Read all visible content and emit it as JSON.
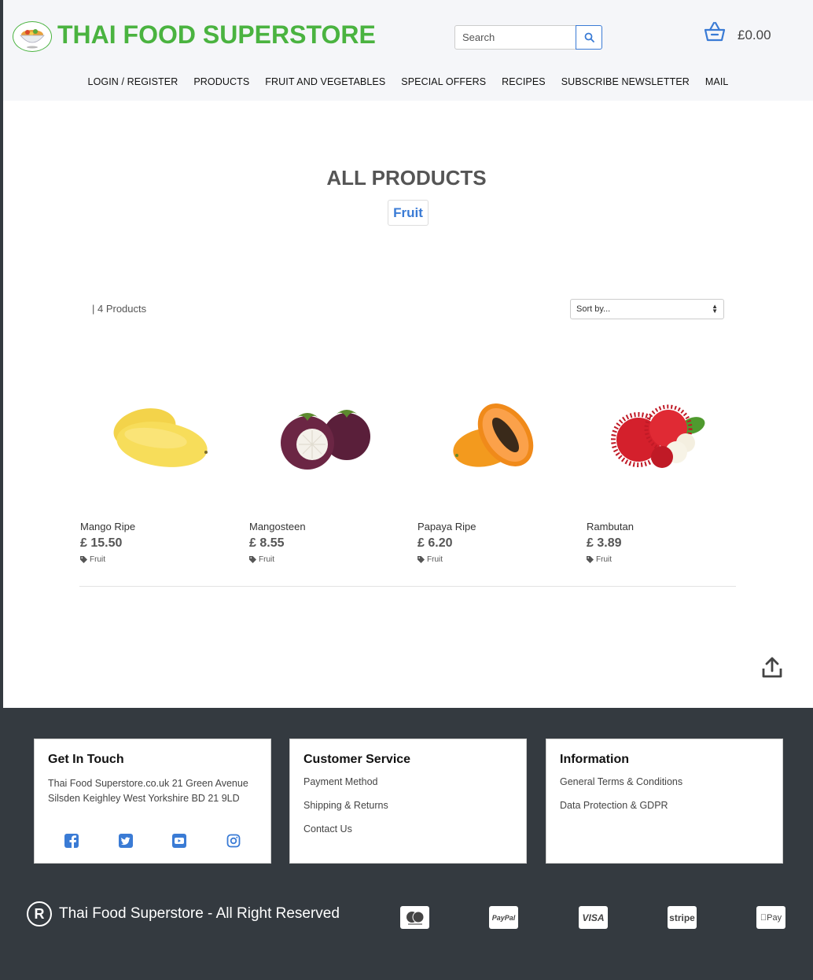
{
  "header": {
    "brand": "THAI FOOD SUPERSTORE",
    "search_placeholder": "Search",
    "cart_total": "£0.00",
    "nav": [
      "LOGIN / REGISTER",
      "PRODUCTS",
      "FRUIT AND VEGETABLES",
      "SPECIAL OFFERS",
      "RECIPES",
      "SUBSCRIBE NEWSLETTER",
      "MAIL"
    ]
  },
  "main": {
    "title": "ALL PRODUCTS",
    "category_badge": "Fruit",
    "product_count": "| 4 Products",
    "sort_label": "Sort by...",
    "products": [
      {
        "name": "Mango Ripe",
        "price": "£ 15.50",
        "category": "Fruit",
        "image": "mango"
      },
      {
        "name": "Mangosteen",
        "price": "£ 8.55",
        "category": "Fruit",
        "image": "mangosteen"
      },
      {
        "name": "Papaya Ripe",
        "price": "£ 6.20",
        "category": "Fruit",
        "image": "papaya"
      },
      {
        "name": "Rambutan",
        "price": "£ 3.89",
        "category": "Fruit",
        "image": "rambutan"
      }
    ]
  },
  "footer": {
    "contact": {
      "heading": "Get In Touch",
      "address_line1": "Thai Food Superstore.co.uk 21 Green Avenue",
      "address_line2": "Silsden Keighley West Yorkshire BD 21 9LD",
      "social": [
        "facebook-icon",
        "twitter-icon",
        "youtube-icon",
        "instagram-icon"
      ]
    },
    "customer_service": {
      "heading": "Customer Service",
      "links": [
        "Payment Method",
        "Shipping & Returns",
        "Contact Us"
      ]
    },
    "information": {
      "heading": "Information",
      "links": [
        "General Terms & Conditions",
        "Data Protection & GDPR"
      ]
    },
    "copyright": "Thai Food Superstore - All Right Reserved",
    "payment_methods": [
      "mastercard",
      "PayPal",
      "VISA",
      "stripe",
      "Pay"
    ]
  },
  "colors": {
    "brand_green": "#4ab340",
    "accent_blue": "#3a7bd5",
    "footer_bg": "#343a40"
  }
}
